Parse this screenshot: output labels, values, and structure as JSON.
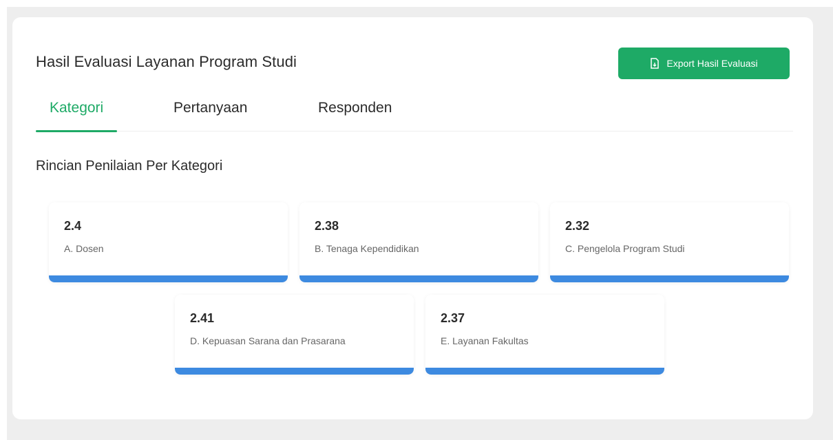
{
  "header": {
    "title": "Hasil Evaluasi Layanan Program Studi",
    "export_label": "Export Hasil Evaluasi",
    "export_icon": "file-export-icon"
  },
  "tabs": [
    {
      "label": "Kategori",
      "active": true
    },
    {
      "label": "Pertanyaan",
      "active": false
    },
    {
      "label": "Responden",
      "active": false
    }
  ],
  "section": {
    "title": "Rincian Penilaian Per Kategori"
  },
  "categories": [
    {
      "score": "2.4",
      "name": "A. Dosen",
      "fill_percent": 100
    },
    {
      "score": "2.38",
      "name": "B. Tenaga Kependidikan",
      "fill_percent": 100
    },
    {
      "score": "2.32",
      "name": "C. Pengelola Program Studi",
      "fill_percent": 100
    },
    {
      "score": "2.41",
      "name": "D. Kepuasan Sarana dan Prasarana",
      "fill_percent": 100
    },
    {
      "score": "2.37",
      "name": "E. Layanan Fakultas",
      "fill_percent": 100
    }
  ],
  "colors": {
    "accent": "#1eaa66",
    "bar": "#3d8ae0",
    "background": "#eeeeee"
  }
}
